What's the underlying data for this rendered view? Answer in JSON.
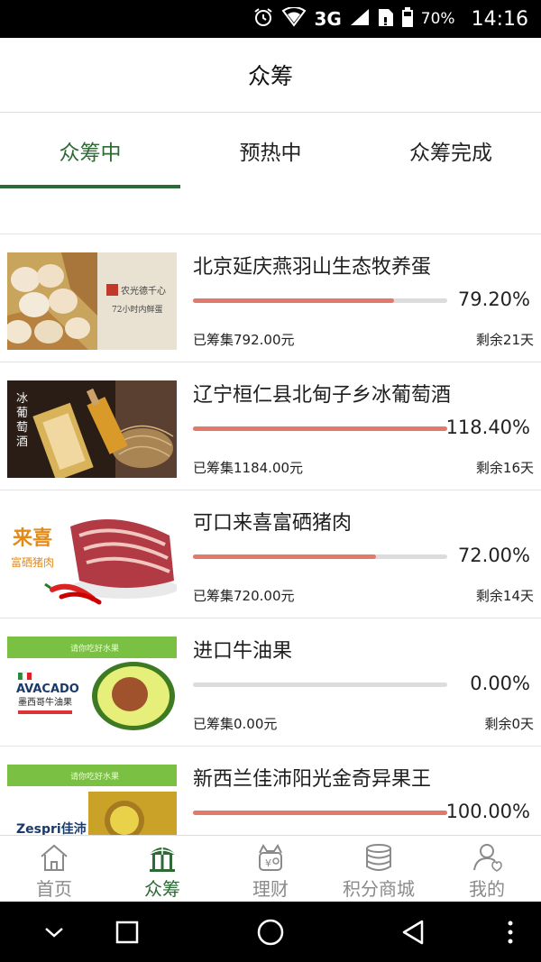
{
  "status_bar": {
    "battery": "70%",
    "network": "3G",
    "time": "14:16"
  },
  "header": {
    "title": "众筹"
  },
  "tabs": [
    {
      "label": "众筹中",
      "active": true
    },
    {
      "label": "预热中",
      "active": false
    },
    {
      "label": "众筹完成",
      "active": false
    }
  ],
  "items": [
    {
      "name": "北京延庆燕羽山生态牧养蛋",
      "percent": "79.20%",
      "progress": 0.792,
      "raised": "已筹集792.00元",
      "remaining": "剩余21天",
      "thumb_text": {
        "line1": "农光德千心",
        "line2": "72小时内鲜蛋"
      }
    },
    {
      "name": "辽宁桓仁县北甸子乡冰葡萄酒",
      "percent": "118.40%",
      "progress": 1.0,
      "raised": "已筹集1184.00元",
      "remaining": "剩余16天",
      "thumb_text": {
        "line1": "冰葡萄酒"
      }
    },
    {
      "name": "可口来喜富硒猪肉",
      "percent": "72.00%",
      "progress": 0.72,
      "raised": "已筹集720.00元",
      "remaining": "剩余14天",
      "thumb_text": {
        "line1": "来喜",
        "line2": "富硒猪肉"
      }
    },
    {
      "name": "进口牛油果",
      "percent": "0.00%",
      "progress": 0.0,
      "raised": "已筹集0.00元",
      "remaining": "剩余0天",
      "thumb_text": {
        "line1": "AVACADO",
        "line2": "墨西哥牛油果",
        "banner": "请你吃好水果"
      }
    },
    {
      "name": "新西兰佳沛阳光金奇异果王",
      "percent": "100.00%",
      "progress": 1.0,
      "raised": "",
      "remaining": "",
      "thumb_text": {
        "line1": "Zespri佳沛",
        "banner": "请你吃好水果"
      }
    }
  ],
  "tabbar": [
    {
      "label": "首页",
      "icon": "home-icon",
      "active": false
    },
    {
      "label": "众筹",
      "icon": "crowdfund-icon",
      "active": true
    },
    {
      "label": "理财",
      "icon": "finance-icon",
      "active": false
    },
    {
      "label": "积分商城",
      "icon": "points-mall-icon",
      "active": false
    },
    {
      "label": "我的",
      "icon": "profile-icon",
      "active": false
    }
  ],
  "colors": {
    "accent": "#2d6a35",
    "progress": "#e07a6b",
    "track": "#dcdcdc"
  }
}
